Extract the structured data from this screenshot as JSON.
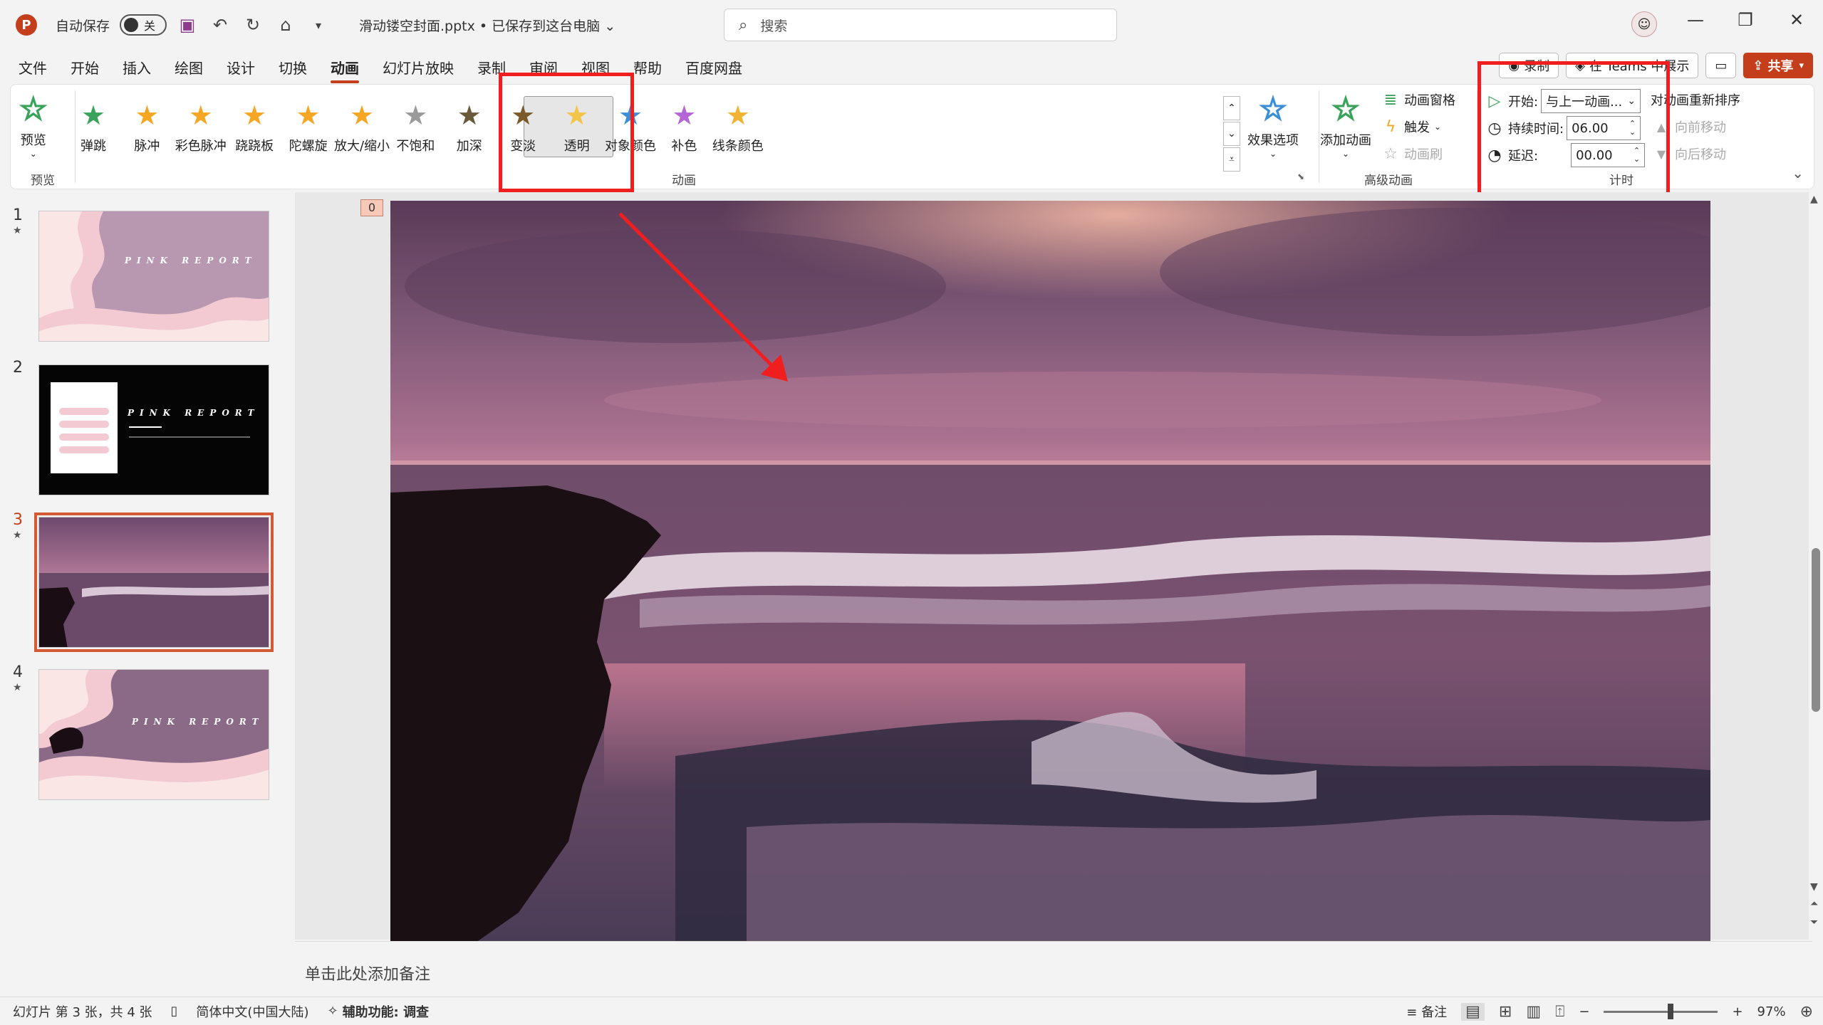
{
  "titlebar": {
    "autosave_label": "自动保存",
    "autosave_state": "关",
    "filename": "滑动镂空封面.pptx • 已保存到这台电脑 ⌄",
    "search_placeholder": "搜索"
  },
  "menu": {
    "items": [
      "文件",
      "开始",
      "插入",
      "绘图",
      "设计",
      "切换",
      "动画",
      "幻灯片放映",
      "录制",
      "审阅",
      "视图",
      "帮助",
      "百度网盘"
    ],
    "active": "动画"
  },
  "top_right": {
    "record": "录制",
    "teams": "在 Teams 中展示",
    "share": "共享"
  },
  "ribbon": {
    "preview": {
      "label": "预览",
      "group": "预览"
    },
    "animations": [
      {
        "label": "弹跳",
        "color": "#3aa35a"
      },
      {
        "label": "脉冲",
        "color": "#f5a623"
      },
      {
        "label": "彩色脉冲",
        "color": "#f5a623"
      },
      {
        "label": "跷跷板",
        "color": "#f5a623"
      },
      {
        "label": "陀螺旋",
        "color": "#f5a623"
      },
      {
        "label": "放大/缩小",
        "color": "#f5a623"
      },
      {
        "label": "不饱和",
        "color": "#9a9a9a"
      },
      {
        "label": "加深",
        "color": "#6b5a3a"
      },
      {
        "label": "变淡",
        "color": "#7a5a2a"
      },
      {
        "label": "透明",
        "color": "#f2c44a"
      },
      {
        "label": "对象颜色",
        "color": "#3a8fd6"
      },
      {
        "label": "补色",
        "color": "#b566d6"
      },
      {
        "label": "线条颜色",
        "color": "#f2b234"
      }
    ],
    "animation_group": "动画",
    "effect_options": "效果选项",
    "advanced": {
      "add_animation": "添加动画",
      "pane": "动画窗格",
      "trigger": "触发",
      "painter": "动画刷",
      "group": "高级动画"
    },
    "timing": {
      "start_label": "开始:",
      "start_value": "与上一动画...",
      "duration_label": "持续时间:",
      "duration_value": "06.00",
      "delay_label": "延迟:",
      "delay_value": "00.00",
      "reorder": "对动画重新排序",
      "move_earlier": "向前移动",
      "move_later": "向后移动",
      "group": "计时"
    }
  },
  "slides": [
    {
      "num": "1",
      "title": "PINK REPORT"
    },
    {
      "num": "2",
      "title": "PINK REPORT"
    },
    {
      "num": "3",
      "title": ""
    },
    {
      "num": "4",
      "title": "PINK REPORT"
    }
  ],
  "editor": {
    "anim_tag": "0"
  },
  "notes": {
    "placeholder": "单击此处添加备注"
  },
  "statusbar": {
    "slide_info": "幻灯片 第 3 张，共 4 张",
    "language": "简体中文(中国大陆)",
    "accessibility": "辅助功能: 调查",
    "notes": "备注",
    "zoom": "97%"
  }
}
